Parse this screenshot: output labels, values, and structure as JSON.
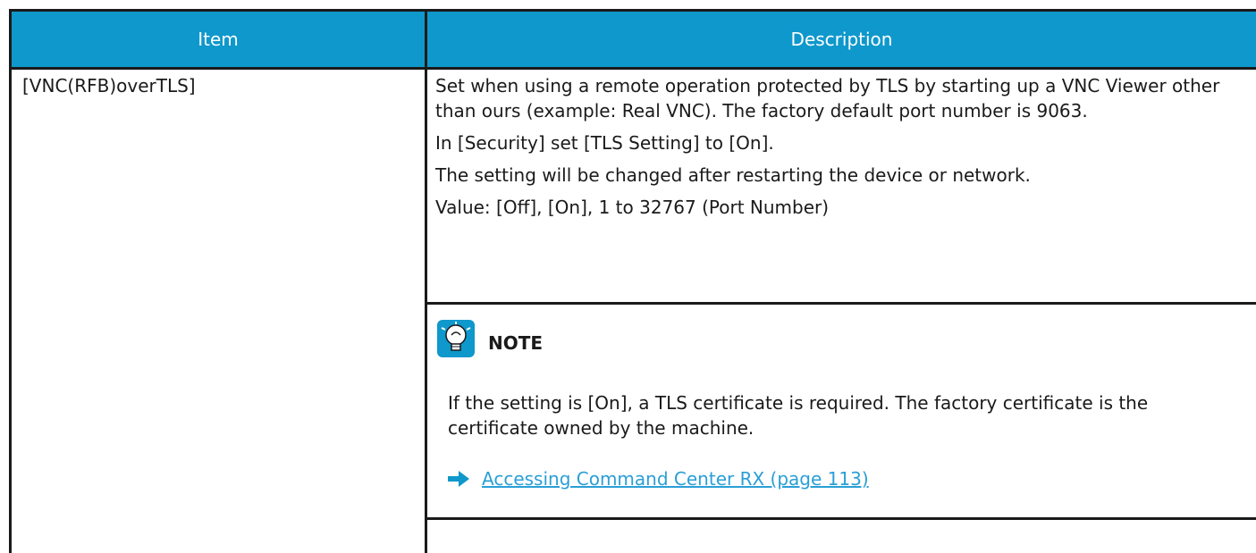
{
  "table": {
    "header": {
      "item": "Item",
      "description": "Description"
    },
    "row": {
      "item": "[VNC(RFB)overTLS]",
      "paragraphs": [
        "Set when using a remote operation protected by TLS by starting up a VNC Viewer other than ours (example: Real VNC). The factory default port number is 9063.",
        "In [Security] set [TLS Setting] to [On].",
        "The setting will be changed after restarting the device or network.",
        "Value: [Off], [On], 1 to 32767 (Port Number)"
      ],
      "note": {
        "icon": "lightbulb-note-icon",
        "title": "NOTE",
        "text": "If the setting is [On], a TLS certificate is required. The factory certificate is the certificate owned by the machine.",
        "link_icon": "arrow-right-icon",
        "link_text": "Accessing Command Center RX (page 113)"
      }
    }
  },
  "colors": {
    "header_bg": "#0e98cc",
    "header_text": "#ffffff",
    "link": "#2a9fd6",
    "border": "#1a1a1a"
  }
}
